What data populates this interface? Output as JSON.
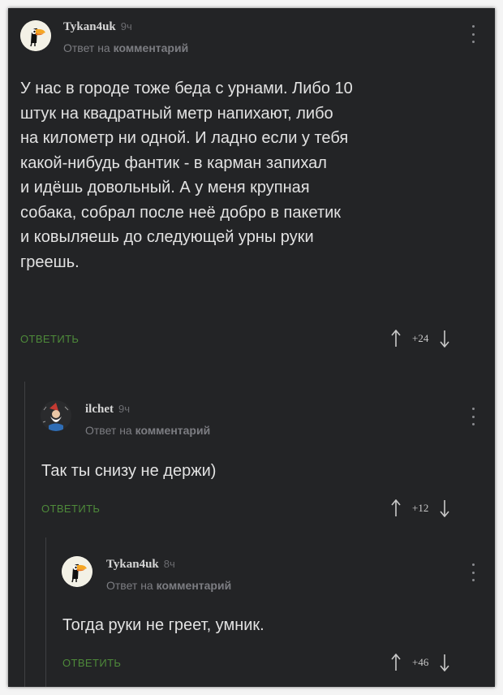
{
  "comments": [
    {
      "username": "Tykan4uk",
      "time": "9ч",
      "reply_prefix": "Ответ на",
      "reply_target": "комментарий",
      "lines": [
        "У нас в городе тоже беда с урнами. Либо 10",
        "штук на квадратный метр напихают, либо",
        "на километр ни одной. И ладно если у тебя",
        "какой-нибудь фантик - в карман запихал",
        "и идёшь довольный. А у меня крупная",
        "собака, собрал после неё добро в пакетик",
        "и ковыляешь до следующей урны руки",
        "греешь."
      ],
      "reply_label": "ОТВЕТИТЬ",
      "score": "+24",
      "avatar": "toucan-avatar"
    },
    {
      "username": "ilchet",
      "time": "9ч",
      "reply_prefix": "Ответ на",
      "reply_target": "комментарий",
      "lines": [
        "Так ты снизу не держи)"
      ],
      "reply_label": "ОТВЕТИТЬ",
      "score": "+12",
      "avatar": "gnome-avatar"
    },
    {
      "username": "Tykan4uk",
      "time": "8ч",
      "reply_prefix": "Ответ на",
      "reply_target": "комментарий",
      "lines": [
        "Тогда руки не греет, умник."
      ],
      "reply_label": "ОТВЕТИТЬ",
      "score": "+46",
      "avatar": "toucan-avatar"
    }
  ],
  "colors": {
    "background": "#232426",
    "text": "#e2e2e2",
    "muted": "#7c7d82",
    "reply_green": "#4e8a3a"
  },
  "icons": [
    "more-vertical-icon",
    "upvote-arrow-icon",
    "downvote-arrow-icon"
  ]
}
